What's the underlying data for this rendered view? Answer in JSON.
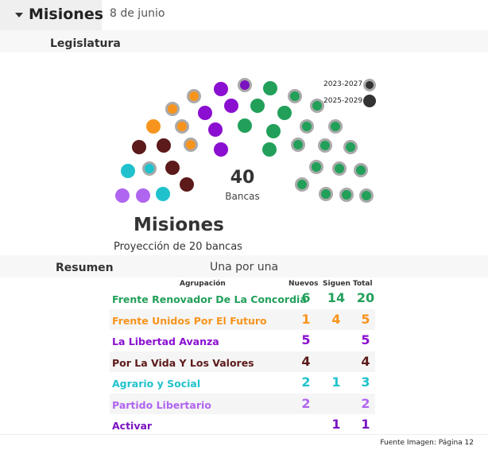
{
  "header": {
    "title": "Misiones",
    "date": "8 de junio"
  },
  "section_legislatura": "Legislatura",
  "chamber": {
    "total": "40",
    "total_label": "Bancas",
    "legend": [
      {
        "label": "2023-2027",
        "style": "outlined"
      },
      {
        "label": "2025-2029",
        "style": "solid"
      }
    ],
    "colors": {
      "Frente Renovador De La Concordia": "#22a05a",
      "Frente Unidos Por El Futuro": "#f7941d",
      "La Libertad Avanza": "#8a0fd1",
      "Por La Vida Y Los Valores": "#5c1a1a",
      "Agrario y Social": "#1fc2cc",
      "Partido Libertario": "#b065f0",
      "Activar": "#7a12c0"
    }
  },
  "province": {
    "name": "Misiones",
    "subtitle": "Proyección de 20 bancas"
  },
  "resumen": {
    "label": "Resumen",
    "mode": "Una por una",
    "columns": [
      "Agrupación",
      "Nuevos",
      "Siguen",
      "Total"
    ],
    "rows": [
      {
        "name": "Frente Renovador De La Concordia",
        "color": "#22a05a",
        "nuevos": "6",
        "siguen": "14",
        "total": "20"
      },
      {
        "name": "Frente Unidos Por El Futuro",
        "color": "#f7941d",
        "nuevos": "1",
        "siguen": "4",
        "total": "5"
      },
      {
        "name": "La Libertad Avanza",
        "color": "#8a0fd1",
        "nuevos": "5",
        "siguen": "",
        "total": "5"
      },
      {
        "name": "Por La Vida Y Los Valores",
        "color": "#5c1a1a",
        "nuevos": "4",
        "siguen": "",
        "total": "4"
      },
      {
        "name": "Agrario y Social",
        "color": "#1fc2cc",
        "nuevos": "2",
        "siguen": "1",
        "total": "3"
      },
      {
        "name": "Partido Libertario",
        "color": "#b065f0",
        "nuevos": "2",
        "siguen": "",
        "total": "2"
      },
      {
        "name": "Activar",
        "color": "#7a12c0",
        "nuevos": "",
        "siguen": "1",
        "total": "1"
      }
    ]
  },
  "source": "Fuente Imagen: Página 12"
}
